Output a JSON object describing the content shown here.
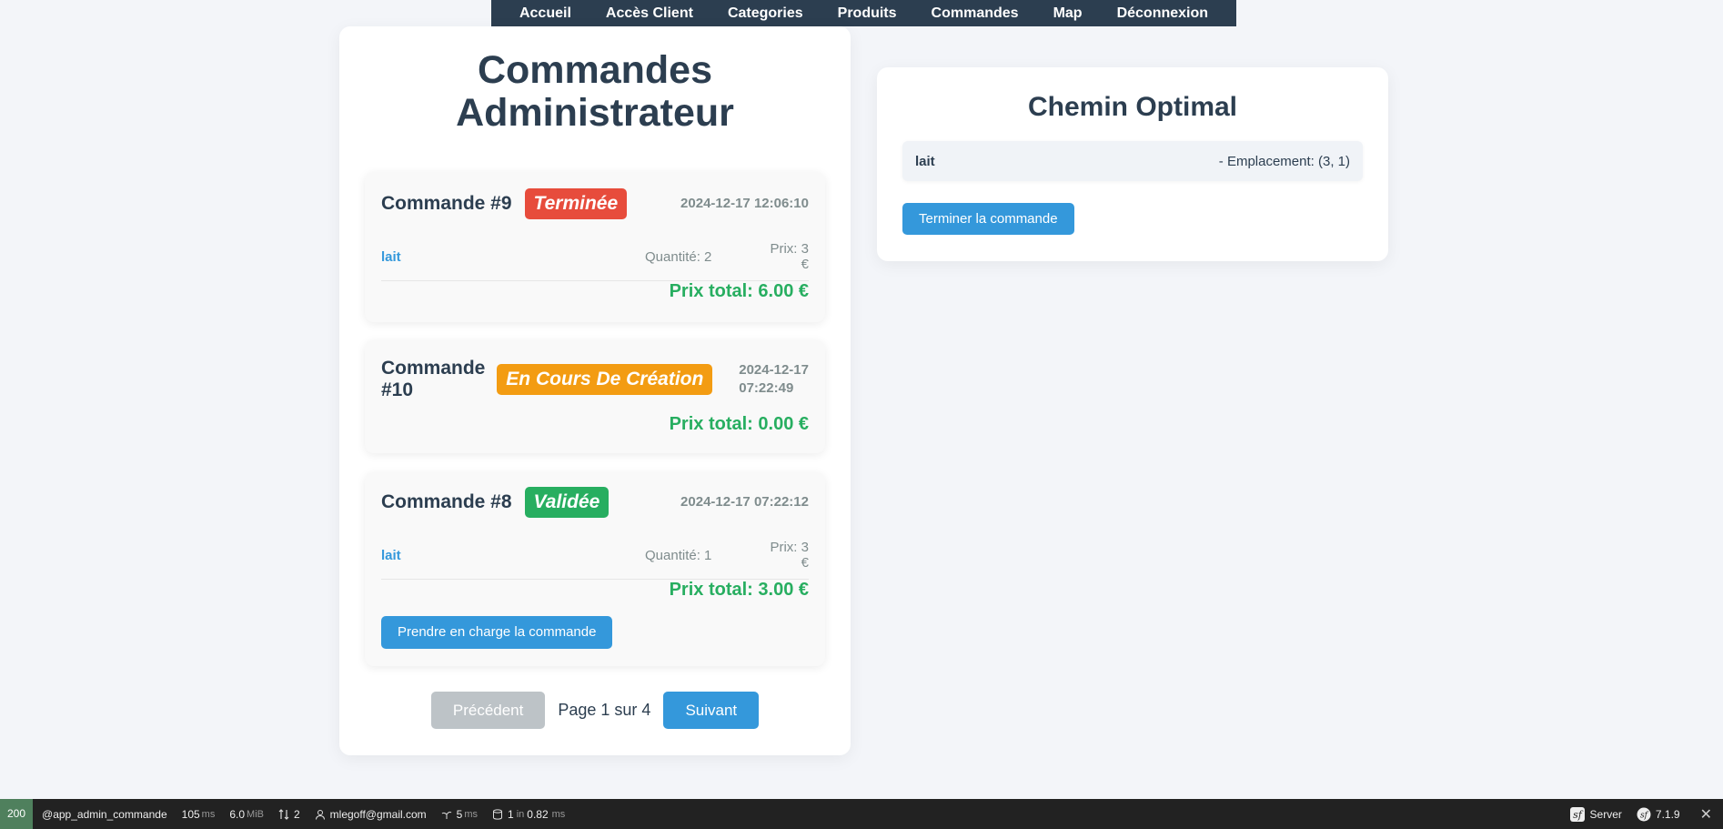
{
  "nav": {
    "items": [
      "Accueil",
      "Accès Client",
      "Categories",
      "Produits",
      "Commandes",
      "Map",
      "Déconnexion"
    ]
  },
  "main": {
    "title_line1": "Commandes",
    "title_line2": "Administrateur",
    "orders": [
      {
        "name": "Commande #9",
        "status": "Terminée",
        "status_color": "#e74c3c",
        "date": "2024-12-17 12:06:10",
        "items": [
          {
            "name": "lait",
            "quantity": "Quantité: 2",
            "price": "Prix: 3 €"
          }
        ],
        "total": "Prix total: 6.00 €"
      },
      {
        "name_line1": "Commande",
        "name_line2": "#10",
        "status": "En Cours De Création",
        "status_color": "#f39c12",
        "date_line1": "2024-12-17",
        "date_line2": "07:22:49",
        "total": "Prix total: 0.00 €"
      },
      {
        "name": "Commande #8",
        "status": "Validée",
        "status_color": "#27ae60",
        "date": "2024-12-17 07:22:12",
        "items": [
          {
            "name": "lait",
            "quantity": "Quantité: 1",
            "price": "Prix: 3 €"
          }
        ],
        "total": "Prix total: 3.00 €",
        "action_label": "Prendre en charge la commande"
      }
    ],
    "pagination": {
      "prev_label": "Précédent",
      "info": "Page 1 sur 4",
      "next_label": "Suivant"
    }
  },
  "path": {
    "title": "Chemin Optimal",
    "items": [
      {
        "name": "lait",
        "location": "- Emplacement: (3, 1)"
      }
    ],
    "finish_label": "Terminer la commande"
  },
  "toolbar": {
    "status_code": "200",
    "route": "@app_admin_commande",
    "time": "105",
    "time_unit": "ms",
    "memory": "6.0",
    "memory_unit": "MiB",
    "requests": "2",
    "user": "mlegoff@gmail.com",
    "twig_time": "5",
    "twig_unit": "ms",
    "db_count": "1",
    "db_in": "in",
    "db_time": "0.82",
    "db_unit": "ms",
    "server_label": "Server",
    "version": "7.1.9"
  },
  "colors": {
    "primary": "#3498db",
    "dark": "#2c3e50",
    "success": "#27ae60",
    "danger": "#e74c3c",
    "warning": "#f39c12"
  }
}
